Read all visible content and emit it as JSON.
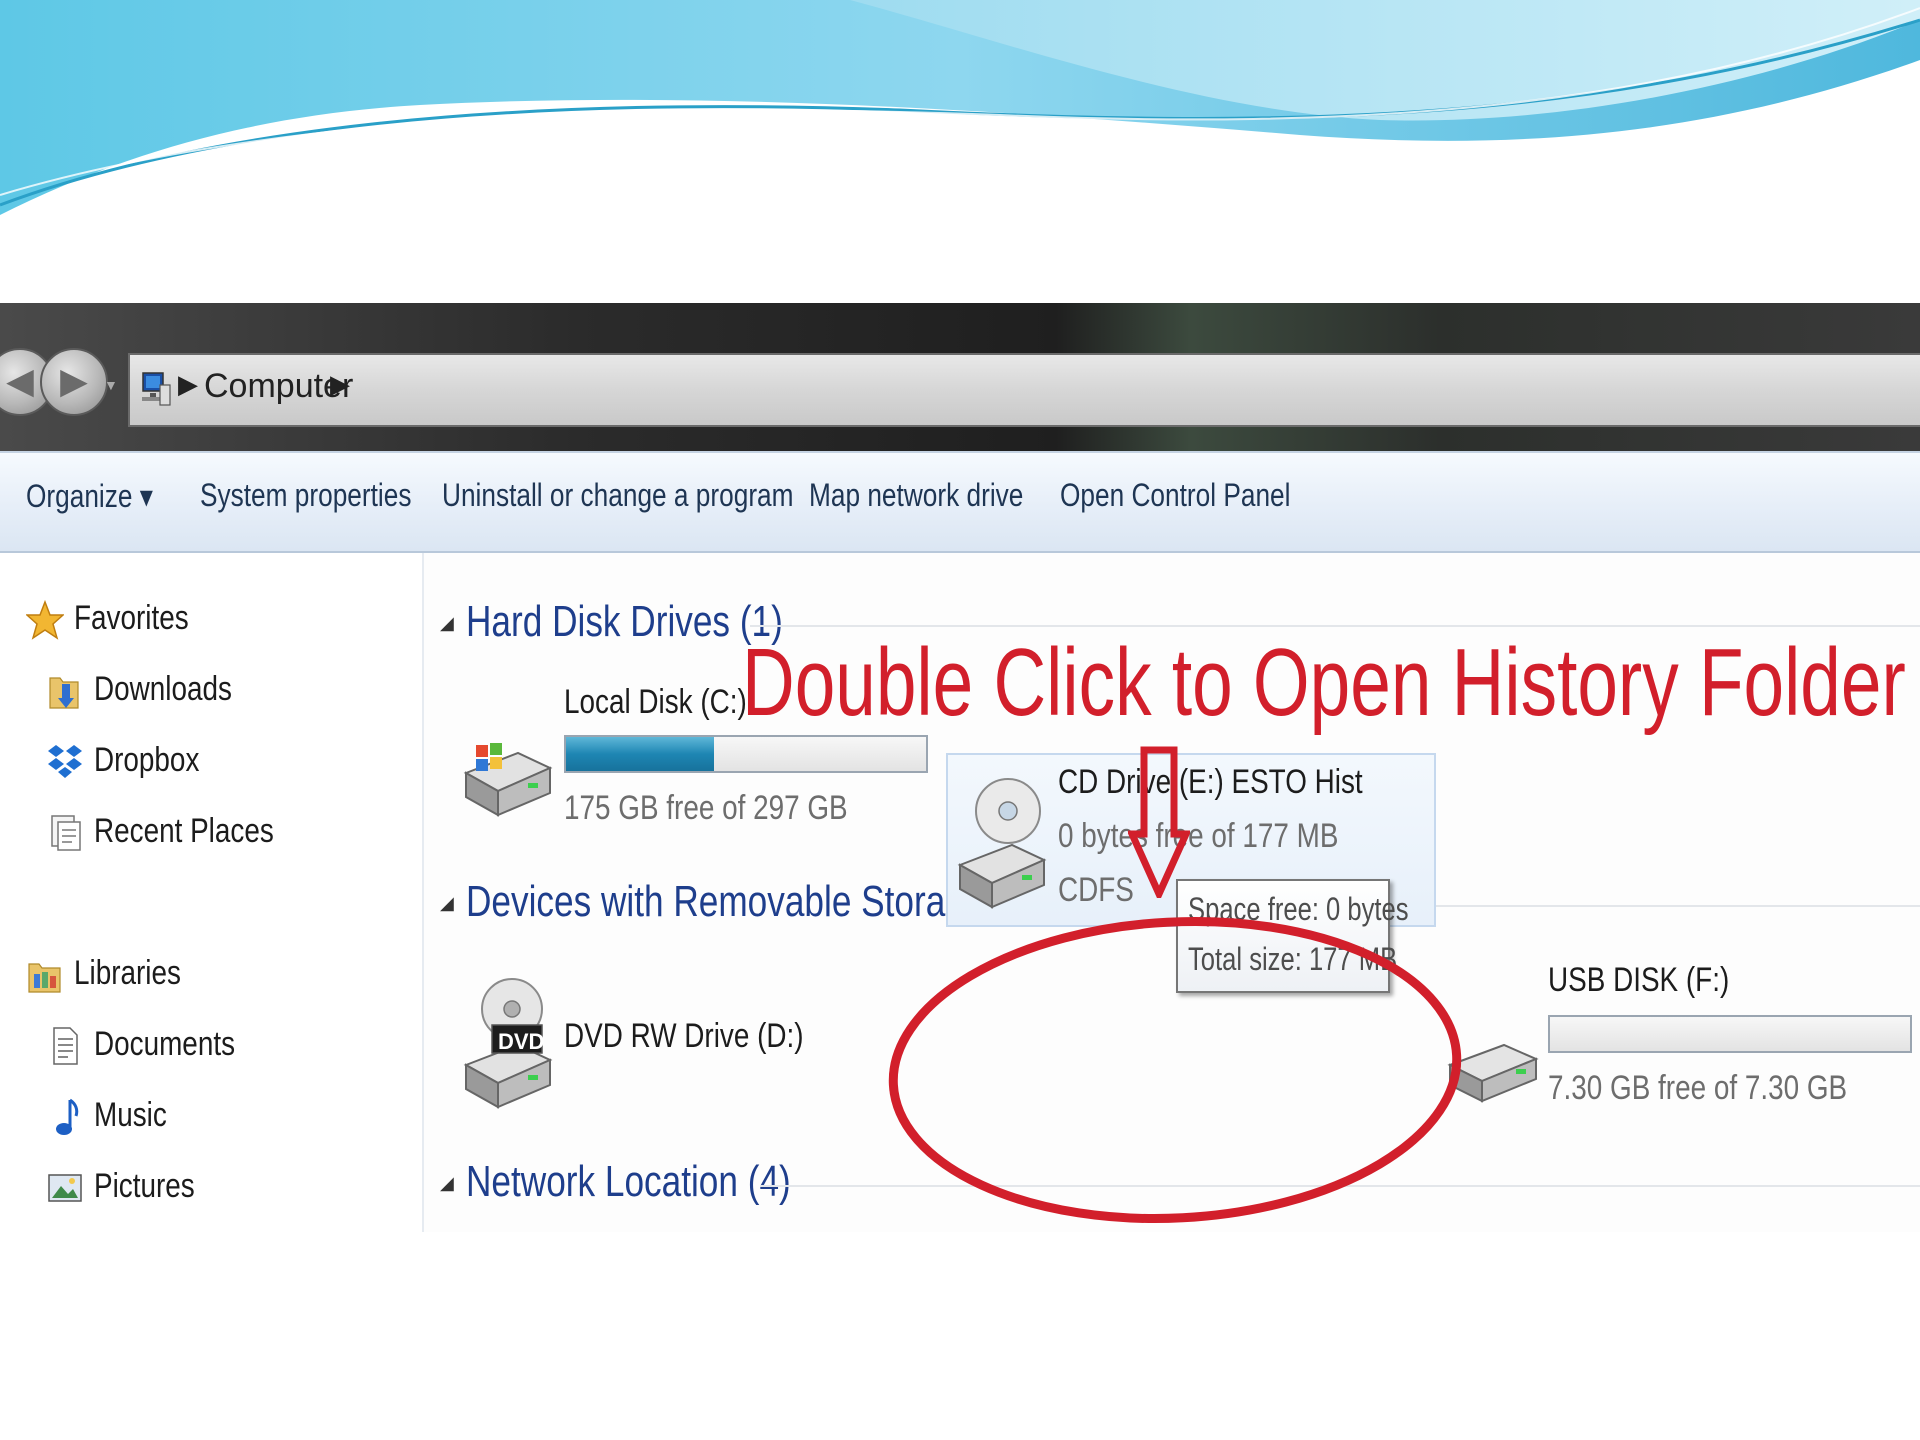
{
  "window": {
    "address_bar": {
      "location": "Computer",
      "separator_glyph": "▶"
    }
  },
  "toolbar": {
    "items": [
      {
        "label": "Organize ▾"
      },
      {
        "label": "System properties"
      },
      {
        "label": "Uninstall or change a program"
      },
      {
        "label": "Map network drive"
      },
      {
        "label": "Open Control Panel"
      }
    ]
  },
  "sidebar": {
    "favorites": {
      "label": "Favorites",
      "icon": "star-icon",
      "items": [
        {
          "label": "Downloads",
          "icon": "downloads-folder-icon"
        },
        {
          "label": "Dropbox",
          "icon": "dropbox-icon"
        },
        {
          "label": "Recent Places",
          "icon": "recent-places-icon"
        }
      ]
    },
    "libraries": {
      "label": "Libraries",
      "icon": "libraries-icon",
      "items": [
        {
          "label": "Documents",
          "icon": "documents-icon"
        },
        {
          "label": "Music",
          "icon": "music-icon"
        },
        {
          "label": "Pictures",
          "icon": "pictures-icon"
        }
      ]
    }
  },
  "groups": {
    "hard_disk": {
      "title": "Hard Disk Drives (1)",
      "drives": [
        {
          "name": "Local Disk (C:)",
          "info": "175 GB free of 297 GB",
          "used_fraction": 0.41,
          "icon": "hard-drive-icon"
        }
      ]
    },
    "removable": {
      "title": "Devices with Removable Storage (3)",
      "dvd": {
        "name": "DVD RW Drive (D:)",
        "badge": "DVD",
        "icon": "dvd-drive-icon"
      },
      "cd": {
        "name": "CD Drive (E:) ESTO Hist",
        "info": "0 bytes free of 177 MB",
        "filesystem": "CDFS",
        "icon": "cd-drive-icon"
      },
      "usb": {
        "name": "USB DISK (F:)",
        "info": "7.30 GB free of 7.30 GB",
        "used_fraction": 0.0,
        "icon": "usb-drive-icon"
      }
    },
    "network": {
      "title": "Network Location (4)"
    }
  },
  "tooltip": {
    "line1": "Space free: 0 bytes",
    "line2": "Total size: 177 MB"
  },
  "annotation": {
    "text": "Double Click to Open History Folder",
    "color": "#d21f2b"
  },
  "colors": {
    "accent_blue": "#1e86b3",
    "annotation_red": "#d21f2b",
    "group_title_blue": "#1e3e8c"
  }
}
